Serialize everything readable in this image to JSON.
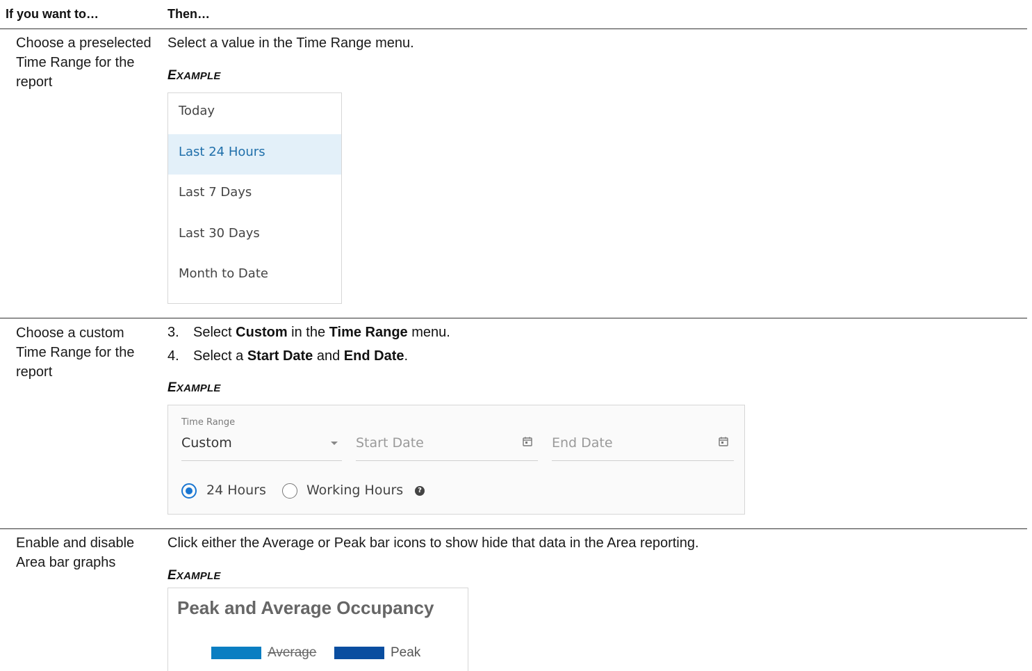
{
  "header": {
    "col1": "If you want to…",
    "col2": "Then…"
  },
  "rows": [
    {
      "left": "Choose a preselected Time Range for the report",
      "instruction": "Select a value in the Time Range menu.",
      "example_label": "EXAMPLE",
      "menu_items": [
        "Today",
        "Last 24 Hours",
        "Last 7 Days",
        "Last 30 Days",
        "Month to Date"
      ],
      "selected_item": "Last 24 Hours"
    },
    {
      "left": "Choose a custom Time Range for the report",
      "steps": [
        {
          "num": "3.",
          "pre": "Select ",
          "b1": "Custom",
          "mid": " in the ",
          "b2": "Time Range",
          "post": " menu."
        },
        {
          "num": "4.",
          "pre": "Select a ",
          "b1": "Start Date",
          "mid": " and ",
          "b2": "End Date",
          "post": "."
        }
      ],
      "example_label": "EXAMPLE",
      "form": {
        "time_range_label": "Time Range",
        "time_range_value": "Custom",
        "start_date_placeholder": "Start Date",
        "end_date_placeholder": "End Date",
        "radio_24": "24 Hours",
        "radio_working": "Working Hours",
        "selected_radio": "24 Hours"
      }
    },
    {
      "left": "Enable and disable Area bar graphs",
      "instruction": "Click either the Average or Peak bar icons to show hide that data in the Area reporting.",
      "example_label": "EXAMPLE",
      "chart": {
        "title": "Peak and Average Occupancy",
        "legend": [
          {
            "label": "Average",
            "color": "#0a7ec2",
            "disabled": true
          },
          {
            "label": "Peak",
            "color": "#0a4ea0",
            "disabled": false
          }
        ]
      }
    }
  ],
  "colors": {
    "selected_bg": "#e3f0f9",
    "selected_text": "#1f6faa",
    "radio_accent": "#1976d2"
  }
}
